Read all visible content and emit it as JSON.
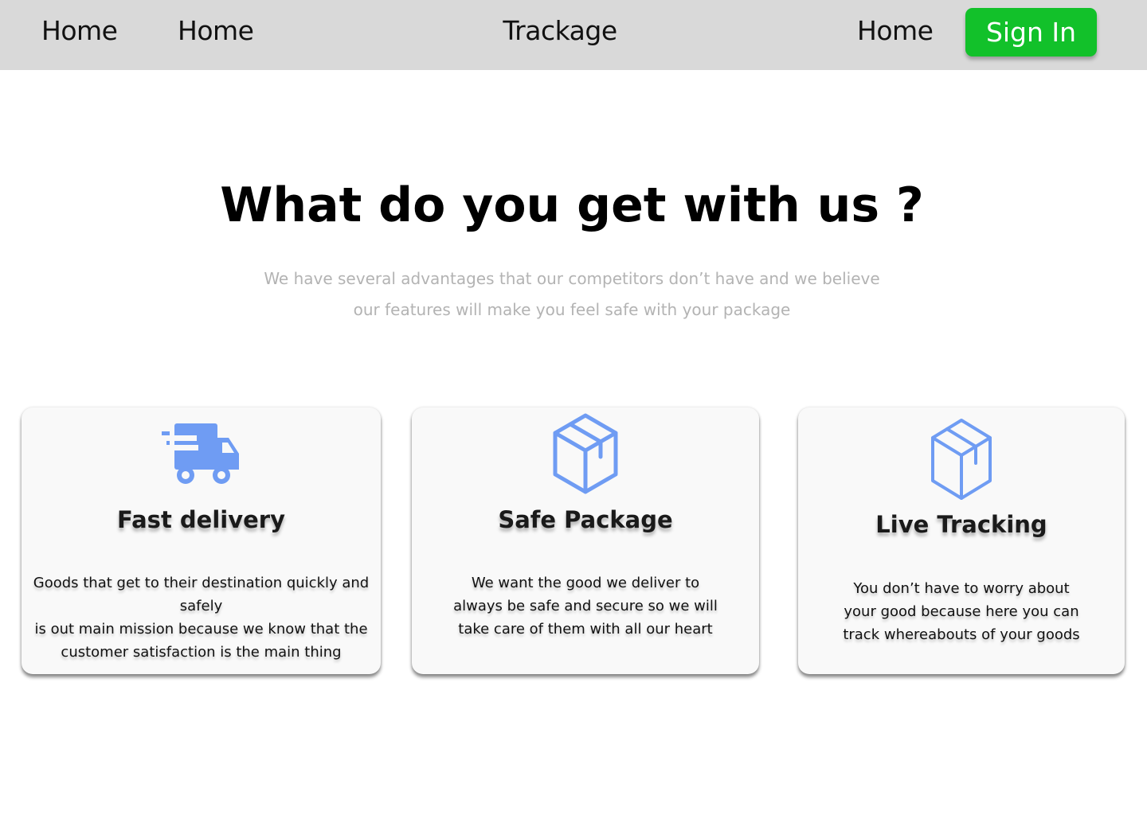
{
  "nav": {
    "links": [
      "Home",
      "Home",
      "Home"
    ],
    "brand": "Trackage",
    "signin_label": "Sign In"
  },
  "hero": {
    "title": "What do you get with us ?",
    "subtitle_line1": "We have several advantages that our competitors don’t have and we believe",
    "subtitle_line2": "our features will make you feel safe with your package"
  },
  "features": [
    {
      "icon": "delivery-truck-icon",
      "title": "Fast delivery",
      "lines": [
        "Goods that get to their destination quickly and safely",
        "is out main mission because we know that the",
        "customer satisfaction is the main thing"
      ]
    },
    {
      "icon": "package-box-icon",
      "title": "Safe Package",
      "lines": [
        "We want the good we deliver to",
        "always be safe and secure so we will",
        "take care of them with all our heart"
      ]
    },
    {
      "icon": "package-box-icon",
      "title": "Live Tracking",
      "lines": [
        "You don’t have to worry about",
        "your good because here you can",
        "track whereabouts of your goods"
      ]
    }
  ],
  "colors": {
    "navbar_bg": "#d9d9d9",
    "signin_bg": "#12c12a",
    "icon_blue": "#6f9cf3",
    "card_bg": "#f9f9f9",
    "subtitle_gray": "#b3b3b3"
  }
}
